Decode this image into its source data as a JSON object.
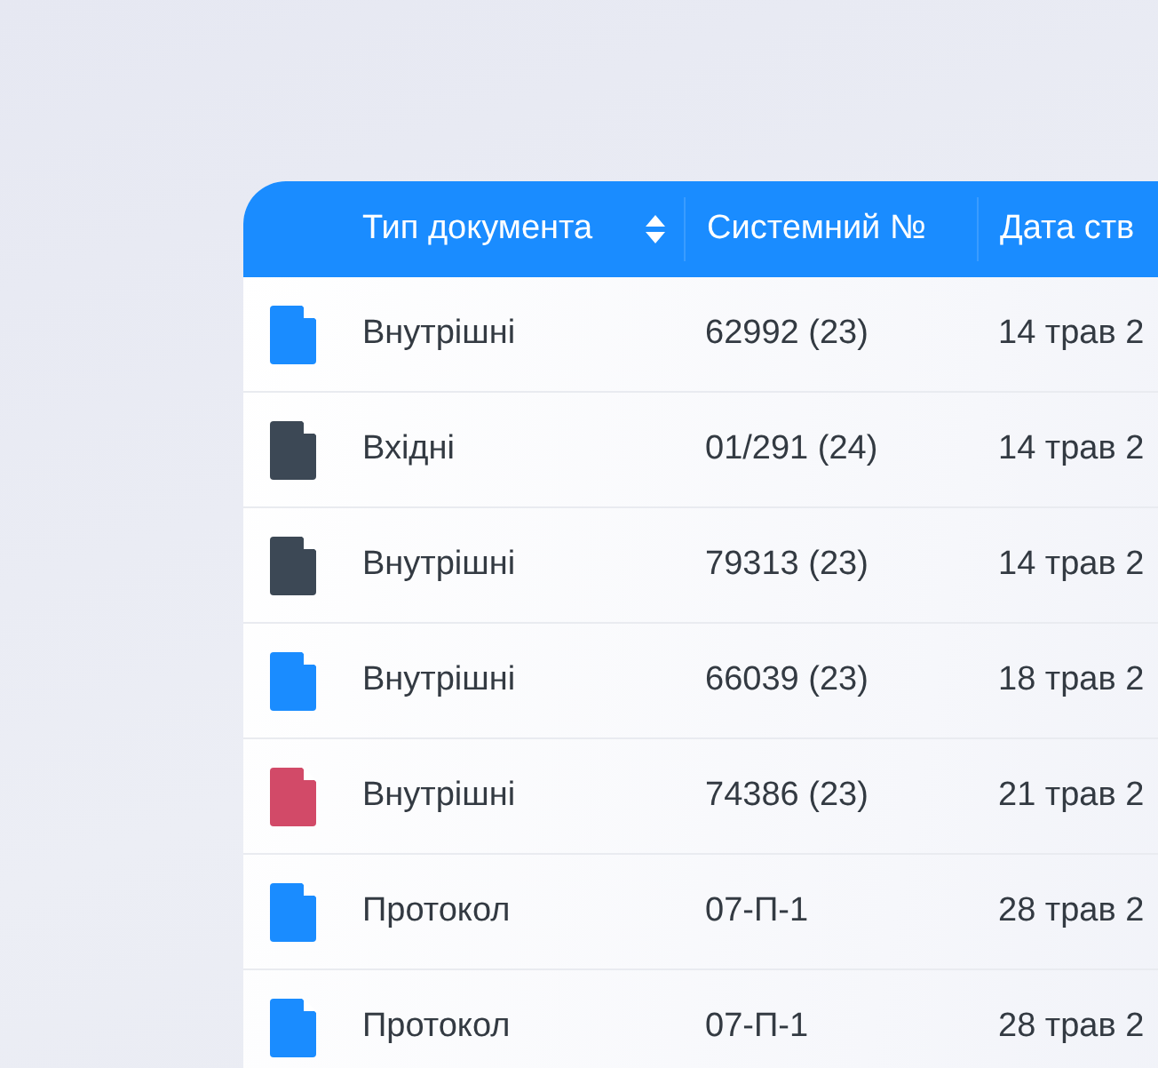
{
  "table": {
    "columns": [
      {
        "label": "Тип документа",
        "sortable": true
      },
      {
        "label": "Системний №",
        "sortable": false
      },
      {
        "label": "Дата ств",
        "sortable": false
      }
    ],
    "rows": [
      {
        "color": "#1a8cff",
        "type": "Внутрішні",
        "number": "62992 (23)",
        "date": "14 трав 2"
      },
      {
        "color": "#3c4855",
        "type": "Вхідні",
        "number": "01/291 (24)",
        "date": "14 трав 2"
      },
      {
        "color": "#3c4855",
        "type": "Внутрішні",
        "number": "79313 (23)",
        "date": "14 трав 2"
      },
      {
        "color": "#1a8cff",
        "type": "Внутрішні",
        "number": "66039 (23)",
        "date": "18 трав 2"
      },
      {
        "color": "#d24a68",
        "type": "Внутрішні",
        "number": "74386 (23)",
        "date": "21 трав 2"
      },
      {
        "color": "#1a8cff",
        "type": "Протокол",
        "number": "07-П-1",
        "date": "28 трав 2"
      },
      {
        "color": "#1a8cff",
        "type": "Протокол",
        "number": "07-П-1",
        "date": "28 трав 2"
      }
    ]
  }
}
